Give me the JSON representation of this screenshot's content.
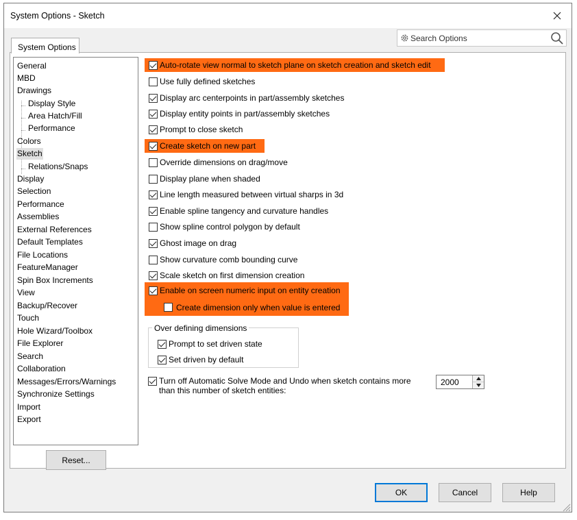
{
  "window": {
    "title": "System Options - Sketch"
  },
  "search": {
    "placeholder": "Search Options"
  },
  "tabs": [
    {
      "label": "System Options"
    }
  ],
  "tree": [
    {
      "label": "General",
      "level": 0
    },
    {
      "label": "MBD",
      "level": 0
    },
    {
      "label": "Drawings",
      "level": 0
    },
    {
      "label": "Display Style",
      "level": 1
    },
    {
      "label": "Area Hatch/Fill",
      "level": 1
    },
    {
      "label": "Performance",
      "level": 1
    },
    {
      "label": "Colors",
      "level": 0
    },
    {
      "label": "Sketch",
      "level": 0,
      "selected": true
    },
    {
      "label": "Relations/Snaps",
      "level": 1
    },
    {
      "label": "Display",
      "level": 0
    },
    {
      "label": "Selection",
      "level": 0
    },
    {
      "label": "Performance",
      "level": 0
    },
    {
      "label": "Assemblies",
      "level": 0
    },
    {
      "label": "External References",
      "level": 0
    },
    {
      "label": "Default Templates",
      "level": 0
    },
    {
      "label": "File Locations",
      "level": 0
    },
    {
      "label": "FeatureManager",
      "level": 0
    },
    {
      "label": "Spin Box Increments",
      "level": 0
    },
    {
      "label": "View",
      "level": 0
    },
    {
      "label": "Backup/Recover",
      "level": 0
    },
    {
      "label": "Touch",
      "level": 0
    },
    {
      "label": "Hole Wizard/Toolbox",
      "level": 0
    },
    {
      "label": "File Explorer",
      "level": 0
    },
    {
      "label": "Search",
      "level": 0
    },
    {
      "label": "Collaboration",
      "level": 0
    },
    {
      "label": "Messages/Errors/Warnings",
      "level": 0
    },
    {
      "label": "Synchronize Settings",
      "level": 0
    },
    {
      "label": "Import",
      "level": 0
    },
    {
      "label": "Export",
      "level": 0
    }
  ],
  "reset_label": "Reset...",
  "options": [
    {
      "label": "Auto-rotate view normal to sketch plane on sketch creation and sketch edit",
      "checked": true,
      "highlighted": true
    },
    {
      "label": "Use fully defined sketches",
      "checked": false,
      "highlighted": false
    },
    {
      "label": "Display arc centerpoints in part/assembly sketches",
      "checked": true,
      "highlighted": false
    },
    {
      "label": "Display entity points in part/assembly sketches",
      "checked": true,
      "highlighted": false
    },
    {
      "label": "Prompt to close sketch",
      "checked": true,
      "highlighted": false
    },
    {
      "label": "Create sketch on new part",
      "checked": true,
      "highlighted": true
    },
    {
      "label": "Override dimensions on drag/move",
      "checked": false,
      "highlighted": false
    },
    {
      "label": "Display plane when shaded",
      "checked": false,
      "highlighted": false
    },
    {
      "label": "Line length measured between virtual sharps in 3d",
      "checked": true,
      "highlighted": false
    },
    {
      "label": "Enable spline tangency and curvature handles",
      "checked": true,
      "highlighted": false
    },
    {
      "label": "Show spline control polygon by default",
      "checked": false,
      "highlighted": false
    },
    {
      "label": "Ghost image on drag",
      "checked": true,
      "highlighted": false
    },
    {
      "label": "Show curvature comb bounding curve",
      "checked": false,
      "highlighted": false
    },
    {
      "label": "Scale sketch on first dimension creation",
      "checked": true,
      "highlighted": false
    },
    {
      "label": "Enable on screen numeric input on entity creation",
      "checked": true,
      "highlighted": true
    },
    {
      "label": "Create dimension only when value is entered",
      "checked": false,
      "highlighted": true,
      "indent": true
    }
  ],
  "over_defining": {
    "legend": "Over defining dimensions",
    "items": [
      {
        "label": "Prompt to set driven state",
        "checked": true
      },
      {
        "label": "Set driven by default",
        "checked": true
      }
    ]
  },
  "turnoff": {
    "label": "Turn off Automatic Solve Mode and Undo when sketch contains more than this number of sketch entities:",
    "checked": true,
    "value": "2000"
  },
  "buttons": {
    "ok": "OK",
    "cancel": "Cancel",
    "help": "Help"
  },
  "colors": {
    "highlight": "#ff6a13",
    "default_button_border": "#0078d7"
  }
}
